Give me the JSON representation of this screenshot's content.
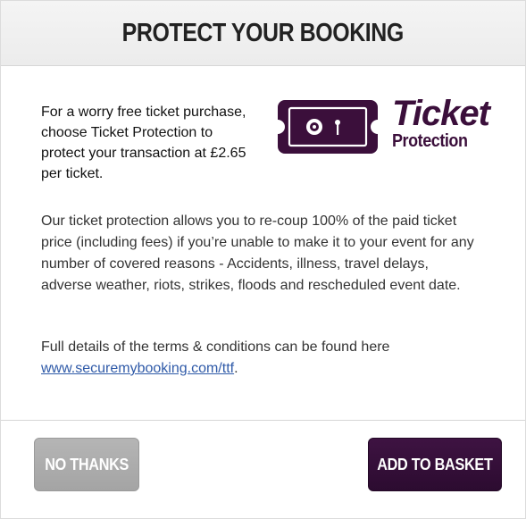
{
  "header": {
    "title": "PROTECT YOUR BOOKING"
  },
  "intro": {
    "text": "For a worry free ticket purchase, choose Ticket Protection to protect your transaction at £2.65 per ticket."
  },
  "logo": {
    "icon": "ticket-icon",
    "word": "Ticket",
    "sub": "Protection",
    "color": "#3b0f3b"
  },
  "description": {
    "text": "Our ticket protection allows you to re-coup 100% of the paid ticket price (including fees) if you’re unable to make it to your event for any number of covered reasons - Accidents, illness, travel delays, adverse weather, riots, strikes, floods and rescheduled event date."
  },
  "terms": {
    "text": "Full details of the terms & conditions can be found here",
    "link": "www.securemybooking.com/ttf",
    "suffix": "."
  },
  "buttons": {
    "no_thanks": "NO THANKS",
    "add_to_basket": "ADD TO BASKET"
  },
  "colors": {
    "brand_purple": "#3b0f3b",
    "button_grey": "#aaaaaa",
    "link": "#2f5aa8"
  }
}
